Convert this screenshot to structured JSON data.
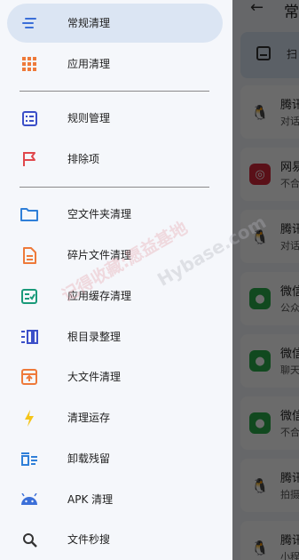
{
  "drawer": {
    "items": [
      {
        "label": "常规清理",
        "icon": "broom-lines-icon",
        "active": true
      },
      {
        "label": "应用清理",
        "icon": "apps-grid-icon"
      },
      {
        "label": "规则管理",
        "icon": "rule-list-icon"
      },
      {
        "label": "排除项",
        "icon": "flag-icon"
      },
      {
        "label": "空文件夹清理",
        "icon": "folder-icon"
      },
      {
        "label": "碎片文件清理",
        "icon": "document-icon"
      },
      {
        "label": "应用缓存清理",
        "icon": "checklist-icon"
      },
      {
        "label": "根目录整理",
        "icon": "columns-icon"
      },
      {
        "label": "大文件清理",
        "icon": "upload-box-icon"
      },
      {
        "label": "清理运存",
        "icon": "flash-icon"
      },
      {
        "label": "卸载残留",
        "icon": "trash-list-icon"
      },
      {
        "label": "APK 清理",
        "icon": "android-icon"
      },
      {
        "label": "文件秒搜",
        "icon": "search-icon"
      }
    ]
  },
  "background": {
    "title": "常",
    "scan_label": "扫",
    "cards": [
      {
        "name": "腾讯",
        "sub": "对话",
        "icon": "qq-icon"
      },
      {
        "name": "网易",
        "sub": "不合",
        "icon": "netease-music-icon"
      },
      {
        "name": "腾讯",
        "sub": "对话",
        "icon": "qq-icon"
      },
      {
        "name": "微信",
        "sub": "公众",
        "icon": "wechat-icon"
      },
      {
        "name": "微信",
        "sub": "聊天",
        "icon": "wechat-icon"
      },
      {
        "name": "微信",
        "sub": "不合",
        "icon": "wechat-icon"
      },
      {
        "name": "腾讯",
        "sub": "拍摄",
        "icon": "qq-icon"
      },
      {
        "name": "腾讯",
        "sub": "小程",
        "icon": "qq-icon"
      }
    ]
  },
  "watermark": {
    "line1": "记得收藏:愿益基地",
    "line2": "Hybase.com"
  },
  "colors": {
    "accent_blue": "#3b6fd8",
    "orange": "#ee7a3a",
    "red": "#e0474c",
    "teal": "#1a9a7a",
    "yellow": "#f5c518",
    "drawer_bg": "#f5f7fb",
    "active_bg": "#dbe5f3"
  }
}
